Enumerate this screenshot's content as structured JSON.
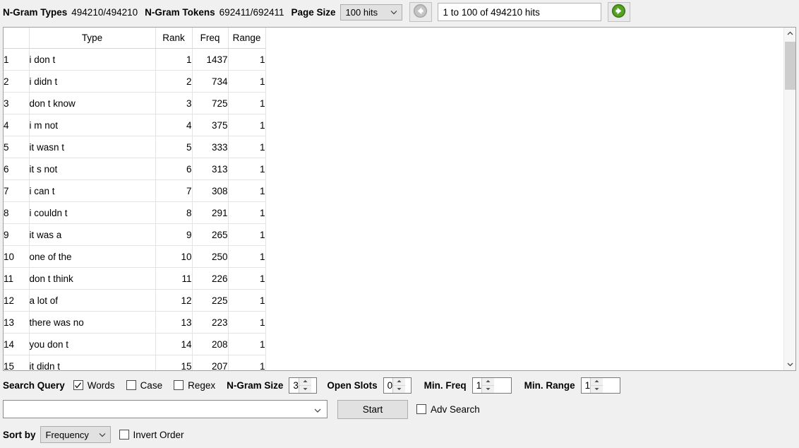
{
  "toolbar": {
    "ngram_types_label": "N-Gram Types",
    "ngram_types_value": "494210/494210",
    "ngram_tokens_label": "N-Gram Tokens",
    "ngram_tokens_value": "692411/692411",
    "page_size_label": "Page Size",
    "page_size_value": "100 hits",
    "hit_range_value": "1 to 100 of 494210 hits",
    "prev_icon": "circle-left-arrow-icon",
    "next_icon": "circle-right-arrow-icon",
    "next_arrow_color": "#4a9a1e",
    "prev_arrow_color": "#9a9a9a"
  },
  "table": {
    "headers": {
      "num": "",
      "type": "Type",
      "rank": "Rank",
      "freq": "Freq",
      "range": "Range"
    },
    "rows": [
      {
        "num": "1",
        "type": "i don t",
        "rank": "1",
        "freq": "1437",
        "range": "1"
      },
      {
        "num": "2",
        "type": "i didn t",
        "rank": "2",
        "freq": "734",
        "range": "1"
      },
      {
        "num": "3",
        "type": "don t know",
        "rank": "3",
        "freq": "725",
        "range": "1"
      },
      {
        "num": "4",
        "type": "i m not",
        "rank": "4",
        "freq": "375",
        "range": "1"
      },
      {
        "num": "5",
        "type": "it wasn t",
        "rank": "5",
        "freq": "333",
        "range": "1"
      },
      {
        "num": "6",
        "type": "it s not",
        "rank": "6",
        "freq": "313",
        "range": "1"
      },
      {
        "num": "7",
        "type": "i can t",
        "rank": "7",
        "freq": "308",
        "range": "1"
      },
      {
        "num": "8",
        "type": "i couldn t",
        "rank": "8",
        "freq": "291",
        "range": "1"
      },
      {
        "num": "9",
        "type": "it was a",
        "rank": "9",
        "freq": "265",
        "range": "1"
      },
      {
        "num": "10",
        "type": "one of the",
        "rank": "10",
        "freq": "250",
        "range": "1"
      },
      {
        "num": "11",
        "type": "don t think",
        "rank": "11",
        "freq": "226",
        "range": "1"
      },
      {
        "num": "12",
        "type": "a lot of",
        "rank": "12",
        "freq": "225",
        "range": "1"
      },
      {
        "num": "13",
        "type": "there was no",
        "rank": "13",
        "freq": "223",
        "range": "1"
      },
      {
        "num": "14",
        "type": "you don t",
        "rank": "14",
        "freq": "208",
        "range": "1"
      },
      {
        "num": "15",
        "type": "it didn t",
        "rank": "15",
        "freq": "207",
        "range": "1"
      }
    ]
  },
  "search_options": {
    "search_query_label": "Search Query",
    "words_label": "Words",
    "words_checked": true,
    "case_label": "Case",
    "case_checked": false,
    "regex_label": "Regex",
    "regex_checked": false,
    "ngram_size_label": "N-Gram Size",
    "ngram_size_value": "3",
    "open_slots_label": "Open Slots",
    "open_slots_value": "0",
    "min_freq_label": "Min. Freq",
    "min_freq_value": "1",
    "min_range_label": "Min. Range",
    "min_range_value": "1"
  },
  "search_input": {
    "query_value": "",
    "start_label": "Start",
    "adv_search_label": "Adv Search",
    "adv_search_checked": false
  },
  "sort": {
    "sort_by_label": "Sort by",
    "sort_by_value": "Frequency",
    "invert_order_label": "Invert Order",
    "invert_order_checked": false
  },
  "scrollbar": {
    "up_icon": "chevron-up-icon",
    "down_icon": "chevron-down-icon"
  }
}
